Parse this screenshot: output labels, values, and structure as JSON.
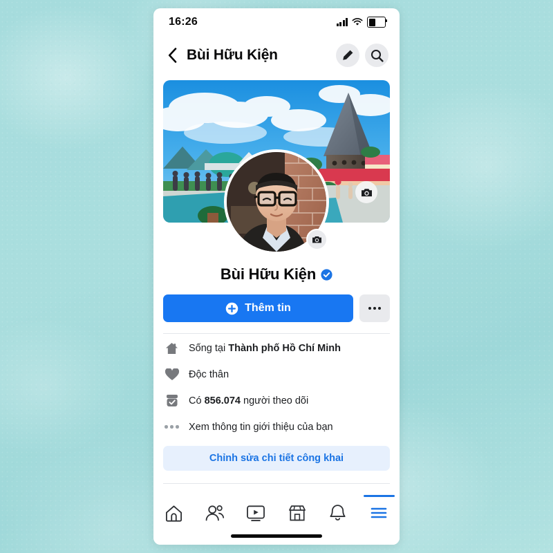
{
  "statusbar": {
    "time": "16:26",
    "signal_icon": "signal-bars-icon",
    "wifi_icon": "wifi-icon",
    "battery_icon": "battery-icon",
    "battery_level_pct": 40
  },
  "header": {
    "back_icon": "chevron-left-icon",
    "title": "Bùi Hữu Kiện",
    "edit_icon": "pencil-icon",
    "search_icon": "search-icon"
  },
  "profile": {
    "cover_photo_alt": "resort with conical stone tower under blue sky",
    "cover_camera_icon": "camera-icon",
    "avatar_alt": "man with black glasses in front of brick wall",
    "avatar_camera_icon": "camera-icon",
    "name": "Bùi Hữu Kiện",
    "verified_icon": "verified-badge-icon",
    "verified": true
  },
  "actions": {
    "primary_icon": "plus-circle-icon",
    "primary_label": "Thêm tin",
    "more_icon": "ellipsis-icon"
  },
  "info_rows": [
    {
      "icon": "home-icon",
      "prefix": "Sống tại ",
      "bold": "Thành phố Hồ Chí Minh",
      "suffix": ""
    },
    {
      "icon": "heart-icon",
      "prefix": "Độc thân",
      "bold": "",
      "suffix": ""
    },
    {
      "icon": "followers-icon",
      "prefix": "Có ",
      "bold": "856.074",
      "suffix": " người theo dõi"
    },
    {
      "icon": "ellipsis-icon",
      "prefix": "Xem thông tin giới thiệu của bạn",
      "bold": "",
      "suffix": ""
    }
  ],
  "edit_public": {
    "label": "Chỉnh sửa chi tiết công khai"
  },
  "bottom_nav": [
    {
      "icon": "home-icon",
      "name": "nav-home",
      "active": false
    },
    {
      "icon": "friends-icon",
      "name": "nav-friends",
      "active": false
    },
    {
      "icon": "video-icon",
      "name": "nav-video",
      "active": false
    },
    {
      "icon": "marketplace-icon",
      "name": "nav-marketplace",
      "active": false
    },
    {
      "icon": "bell-icon",
      "name": "nav-notifications",
      "active": false
    },
    {
      "icon": "menu-icon",
      "name": "nav-menu",
      "active": true
    }
  ],
  "colors": {
    "brand_blue": "#1877f2",
    "link_blue": "#1b74e4",
    "light_blue_bg": "#e7f0fd",
    "grey_bg": "#e9eaed",
    "backdrop_teal": "#a9dddd"
  }
}
